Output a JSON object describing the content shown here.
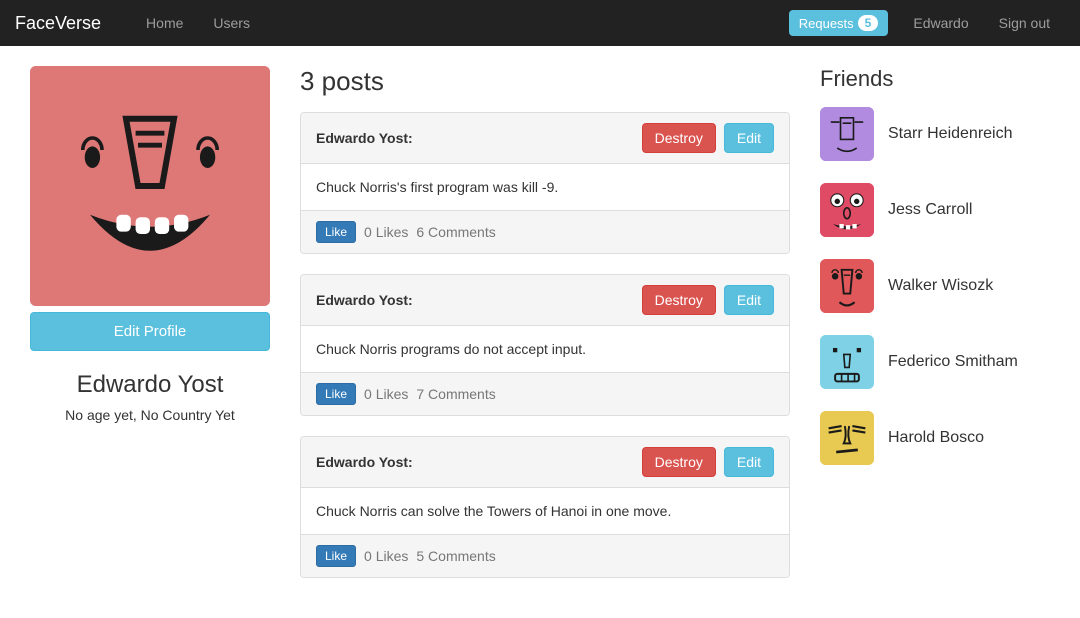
{
  "nav": {
    "brand": "FaceVerse",
    "home": "Home",
    "users": "Users",
    "requests_label": "Requests",
    "requests_count": "5",
    "current_user": "Edwardo",
    "signout": "Sign out"
  },
  "profile": {
    "edit_button": "Edit Profile",
    "name": "Edwardo Yost",
    "sub": "No age yet, No Country Yet"
  },
  "posts_heading": "3 posts",
  "posts": [
    {
      "author": "Edwardo Yost:",
      "destroy": "Destroy",
      "edit": "Edit",
      "body": "Chuck Norris's first program was kill -9.",
      "like": "Like",
      "likes": "0 Likes",
      "comments": "6 Comments"
    },
    {
      "author": "Edwardo Yost:",
      "destroy": "Destroy",
      "edit": "Edit",
      "body": "Chuck Norris programs do not accept input.",
      "like": "Like",
      "likes": "0 Likes",
      "comments": "7 Comments"
    },
    {
      "author": "Edwardo Yost:",
      "destroy": "Destroy",
      "edit": "Edit",
      "body": "Chuck Norris can solve the Towers of Hanoi in one move.",
      "like": "Like",
      "likes": "0 Likes",
      "comments": "5 Comments"
    }
  ],
  "friends_heading": "Friends",
  "friends": [
    {
      "name": "Starr Heidenreich"
    },
    {
      "name": "Jess Carroll"
    },
    {
      "name": "Walker Wisozk"
    },
    {
      "name": "Federico Smitham"
    },
    {
      "name": "Harold Bosco"
    }
  ]
}
